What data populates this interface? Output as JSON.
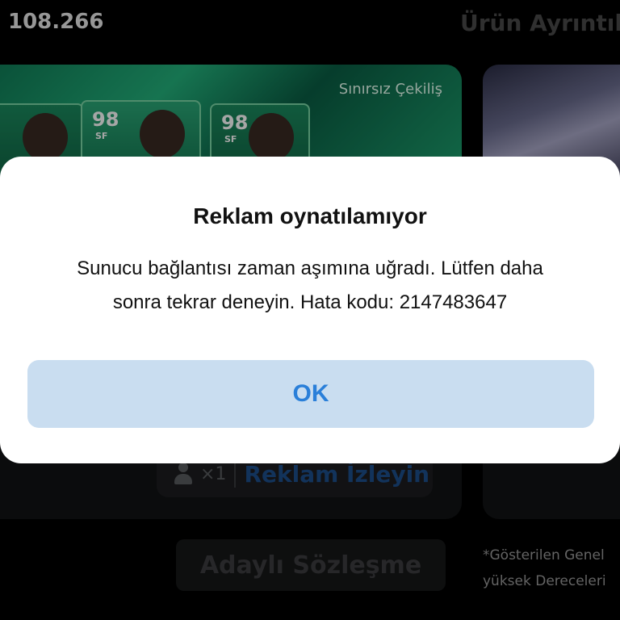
{
  "header": {
    "coins": "108.266",
    "title": "Ürün Ayrıntıla"
  },
  "card": {
    "banner_label": "Sınırsız Çekiliş",
    "players": [
      {
        "rating": "",
        "position": ""
      },
      {
        "rating": "98",
        "position": "SF"
      },
      {
        "rating": "98",
        "position": "SF"
      }
    ],
    "watch": {
      "multiplier": "×1",
      "label": "Reklam İzleyin"
    }
  },
  "contract_button": "Adaylı Sözleşme",
  "footnote": {
    "line1": "*Gösterilen Genel",
    "line2": "yüksek Dereceleri"
  },
  "dialog": {
    "title": "Reklam oynatılamıyor",
    "message_line1": "Sunucu bağlantısı zaman aşımına uğradı. Lütfen daha",
    "message_line2": "sonra tekrar deneyin. Hata kodu: 2147483647",
    "ok_label": "OK"
  },
  "colors": {
    "background": "#000000",
    "dialog_bg": "#ffffff",
    "ok_button_bg": "#c9ddf0",
    "ok_text": "#2a7fd9",
    "banner_green": "#23b27c"
  }
}
